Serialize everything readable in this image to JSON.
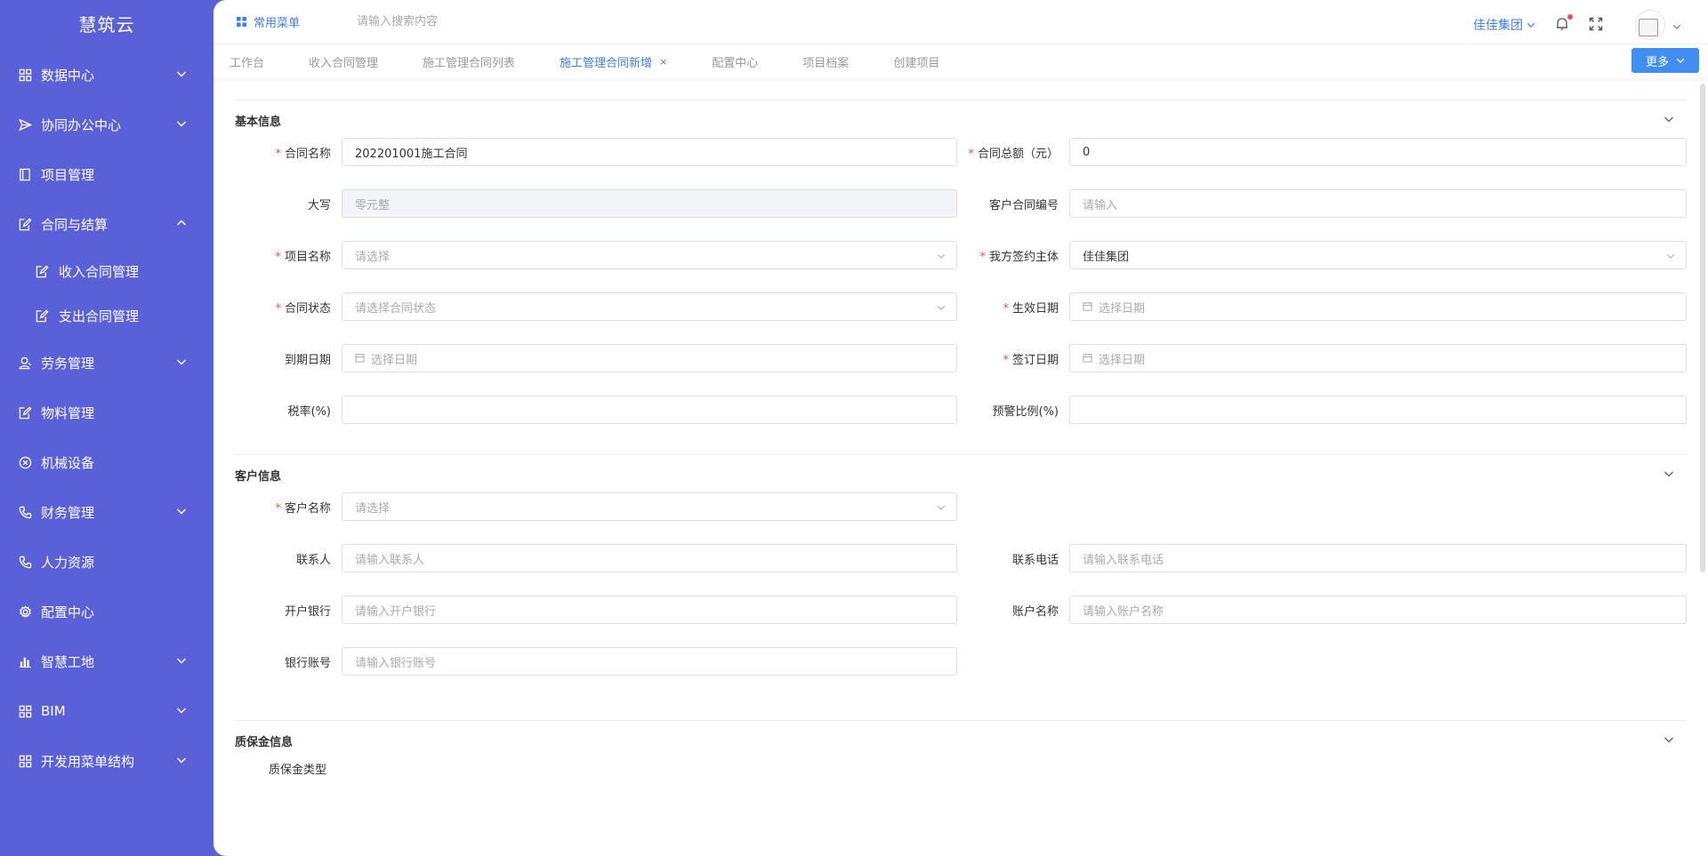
{
  "app": {
    "logo": "慧筑云"
  },
  "sidebar": {
    "items": [
      {
        "label": "数据中心",
        "icon": "grid-icon",
        "arrow": "down"
      },
      {
        "label": "协同办公中心",
        "icon": "send-icon",
        "arrow": "down"
      },
      {
        "label": "项目管理",
        "icon": "book-icon",
        "arrow": ""
      },
      {
        "label": "合同与结算",
        "icon": "edit-icon",
        "arrow": "up"
      },
      {
        "label": "劳务管理",
        "icon": "user-icon",
        "arrow": "down"
      },
      {
        "label": "物料管理",
        "icon": "edit-icon",
        "arrow": ""
      },
      {
        "label": "机械设备",
        "icon": "circle-x-icon",
        "arrow": ""
      },
      {
        "label": "财务管理",
        "icon": "phone-icon",
        "arrow": "down"
      },
      {
        "label": "人力资源",
        "icon": "phone-icon",
        "arrow": ""
      },
      {
        "label": "配置中心",
        "icon": "gear-icon",
        "arrow": ""
      },
      {
        "label": "智慧工地",
        "icon": "bar-chart-icon",
        "arrow": "down"
      },
      {
        "label": "BIM",
        "icon": "grid-icon",
        "arrow": "down"
      },
      {
        "label": "开发用菜单结构",
        "icon": "grid-icon",
        "arrow": "down"
      }
    ],
    "subitems": [
      {
        "label": "收入合同管理"
      },
      {
        "label": "支出合同管理"
      }
    ]
  },
  "topbar": {
    "common_menu": "常用菜单",
    "search_placeholder": "请输入搜索内容",
    "company": "佳佳集团"
  },
  "tabs": [
    {
      "label": "工作台",
      "active": false
    },
    {
      "label": "收入合同管理",
      "active": false
    },
    {
      "label": "施工管理合同列表",
      "active": false
    },
    {
      "label": "施工管理合同新增",
      "active": true,
      "close": "×"
    },
    {
      "label": "配置中心",
      "active": false
    },
    {
      "label": "项目档案",
      "active": false
    },
    {
      "label": "创建项目",
      "active": false
    }
  ],
  "more_button": "更多",
  "sections": {
    "basic": {
      "title": "基本信息",
      "contract_name": {
        "label": "合同名称",
        "value": "202201001施工合同"
      },
      "contract_total": {
        "label": "合同总额（元）",
        "value": "0"
      },
      "uppercase": {
        "label": "大写",
        "value": "零元整"
      },
      "client_contract_no": {
        "label": "客户合同编号",
        "placeholder": "请输入"
      },
      "project_name": {
        "label": "项目名称",
        "placeholder": "请选择"
      },
      "our_signer": {
        "label": "我方签约主体",
        "value": "佳佳集团"
      },
      "contract_status": {
        "label": "合同状态",
        "placeholder": "请选择合同状态"
      },
      "effective_date": {
        "label": "生效日期",
        "placeholder": "选择日期"
      },
      "expire_date": {
        "label": "到期日期",
        "placeholder": "选择日期"
      },
      "sign_date": {
        "label": "签订日期",
        "placeholder": "选择日期"
      },
      "tax_rate": {
        "label": "税率(%)",
        "value": ""
      },
      "warning_ratio": {
        "label": "预警比例(%)",
        "value": ""
      }
    },
    "client": {
      "title": "客户信息",
      "client_name": {
        "label": "客户名称",
        "placeholder": "请选择"
      },
      "contact": {
        "label": "联系人",
        "placeholder": "请输入联系人"
      },
      "phone": {
        "label": "联系电话",
        "placeholder": "请输入联系电话"
      },
      "bank": {
        "label": "开户银行",
        "placeholder": "请输入开户银行"
      },
      "account_name": {
        "label": "账户名称",
        "placeholder": "请输入账户名称"
      },
      "bank_account": {
        "label": "银行账号",
        "placeholder": "请输入银行账号"
      }
    },
    "warranty": {
      "title": "质保金信息",
      "type_label": "质保金类型"
    }
  }
}
